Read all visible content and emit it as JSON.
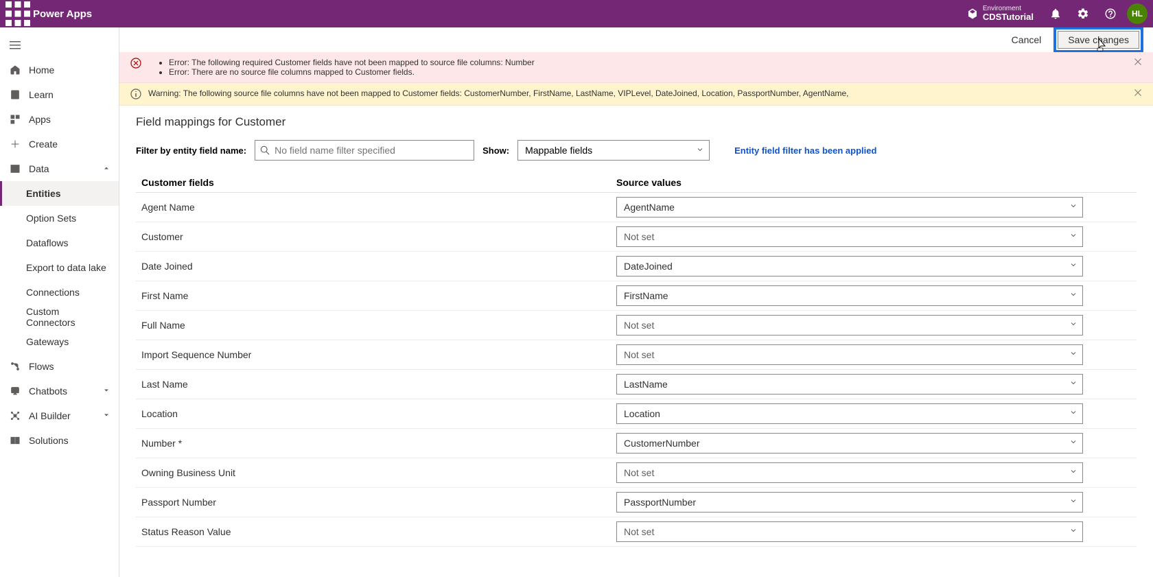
{
  "header": {
    "app_title": "Power Apps",
    "env_label": "Environment",
    "env_name": "CDSTutorial",
    "avatar": "HL"
  },
  "toolbar": {
    "cancel": "Cancel",
    "save": "Save changes"
  },
  "sidebar": {
    "home": "Home",
    "learn": "Learn",
    "apps": "Apps",
    "create": "Create",
    "data": "Data",
    "entities": "Entities",
    "option_sets": "Option Sets",
    "dataflows": "Dataflows",
    "export": "Export to data lake",
    "connections": "Connections",
    "custom_connectors": "Custom Connectors",
    "gateways": "Gateways",
    "flows": "Flows",
    "chatbots": "Chatbots",
    "ai_builder": "AI Builder",
    "solutions": "Solutions"
  },
  "banner": {
    "error1": "Error: The following required Customer fields have not been mapped to source file columns: Number",
    "error2": "Error: There are no source file columns mapped to Customer fields.",
    "warning": "Warning: The following source file columns have not been mapped to Customer fields: CustomerNumber, FirstName, LastName, VIPLevel, DateJoined, Location, PassportNumber, AgentName,"
  },
  "page": {
    "title": "Field mappings for Customer",
    "filter_label": "Filter by entity field name:",
    "filter_placeholder": "No field name filter specified",
    "show_label": "Show:",
    "show_value": "Mappable fields",
    "applied": "Entity field filter has been applied"
  },
  "table": {
    "col_field": "Customer fields",
    "col_source": "Source values",
    "rows": [
      {
        "field": "Agent Name",
        "source": "AgentName"
      },
      {
        "field": "Customer",
        "source": "Not set"
      },
      {
        "field": "Date Joined",
        "source": "DateJoined"
      },
      {
        "field": "First Name",
        "source": "FirstName"
      },
      {
        "field": "Full Name",
        "source": "Not set"
      },
      {
        "field": "Import Sequence Number",
        "source": "Not set"
      },
      {
        "field": "Last Name",
        "source": "LastName"
      },
      {
        "field": "Location",
        "source": "Location"
      },
      {
        "field": "Number *",
        "source": "CustomerNumber"
      },
      {
        "field": "Owning Business Unit",
        "source": "Not set"
      },
      {
        "field": "Passport Number",
        "source": "PassportNumber"
      },
      {
        "field": "Status Reason Value",
        "source": "Not set"
      }
    ]
  }
}
